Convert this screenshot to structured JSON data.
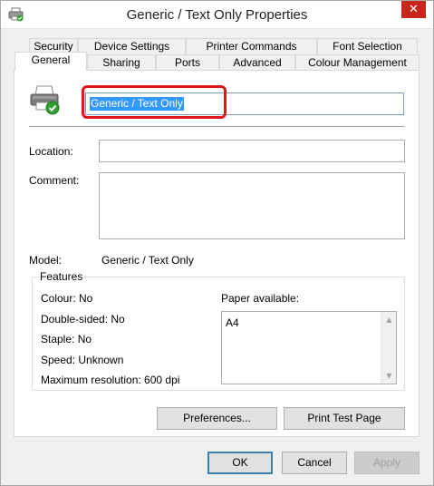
{
  "window": {
    "title": "Generic / Text Only Properties",
    "close_symbol": "✕"
  },
  "tabs": {
    "row1": [
      "Security",
      "Device Settings",
      "Printer Commands",
      "Font Selection"
    ],
    "row2": [
      "General",
      "Sharing",
      "Ports",
      "Advanced",
      "Colour Management"
    ],
    "active": "General"
  },
  "general": {
    "printer_name": "Generic / Text Only",
    "location_label": "Location:",
    "location_value": "",
    "comment_label": "Comment:",
    "comment_value": "",
    "model_label": "Model:",
    "model_value": "Generic / Text Only",
    "features": {
      "legend": "Features",
      "colour": "Colour: No",
      "double_sided": "Double-sided: No",
      "staple": "Staple: No",
      "speed": "Speed: Unknown",
      "max_resolution": "Maximum resolution: 600 dpi",
      "paper_label": "Paper available:",
      "paper_items": [
        "A4"
      ]
    },
    "preferences_button": "Preferences...",
    "print_test_button": "Print Test Page"
  },
  "footer": {
    "ok": "OK",
    "cancel": "Cancel",
    "apply": "Apply"
  },
  "colors": {
    "selection": "#3399ff",
    "highlight_border": "#e0161a",
    "close_button": "#c7271c"
  },
  "icons": {
    "title": "printer-icon",
    "header": "printer-check-icon"
  }
}
